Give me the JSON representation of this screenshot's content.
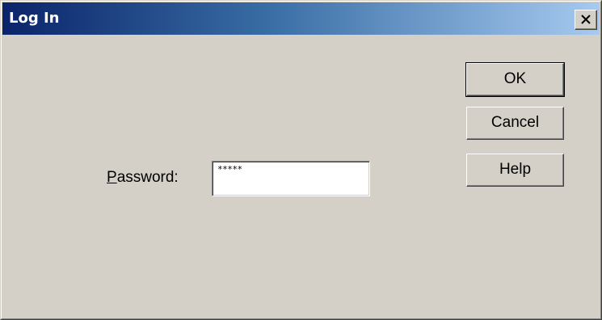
{
  "window": {
    "title": "Log In",
    "close_label": "×"
  },
  "form": {
    "password_label_access_key": "P",
    "password_label_rest": "assword:",
    "password_value": "*****"
  },
  "buttons": {
    "ok_label": "OK",
    "cancel_label": "Cancel",
    "help_label": "Help"
  },
  "icons": {
    "close": "close-icon"
  },
  "colors": {
    "titlebar_start": "#0a246a",
    "titlebar_end": "#a6caf0",
    "face": "#d4d0c8"
  }
}
